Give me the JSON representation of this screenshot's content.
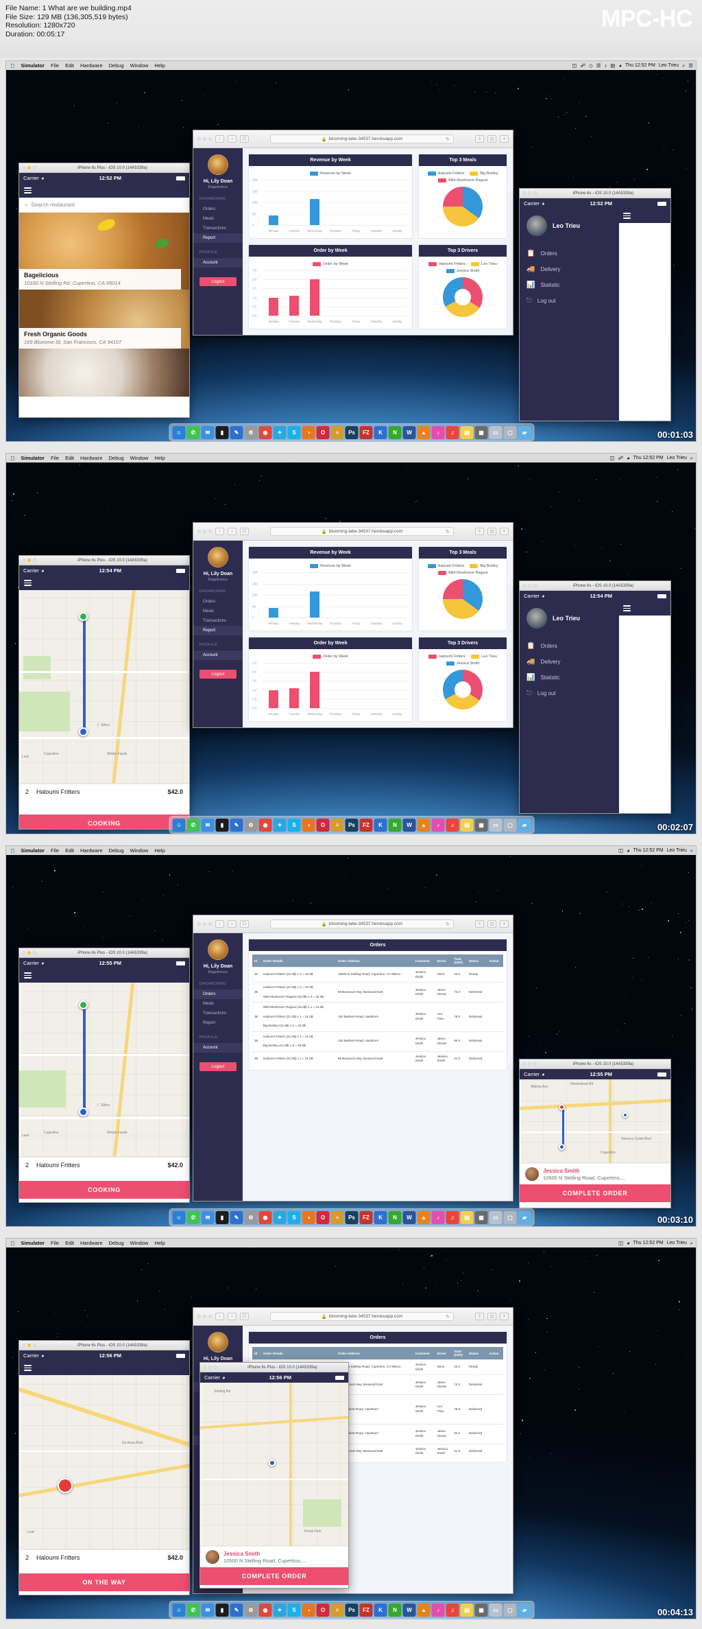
{
  "player": {
    "app_name": "MPC-HC",
    "info_lines": "File Name: 1 What are we building.mp4\nFile Size: 129 MB (136,305,519 bytes)\nResolution: 1280x720\nDuration: 00:05:17",
    "file_name": "1 What are we building.mp4",
    "file_size": "129 MB (136,305,519 bytes)",
    "resolution": "1280x720",
    "duration": "00:05:17"
  },
  "macbar": {
    "apple": "",
    "items": [
      "Simulator",
      "File",
      "Edit",
      "Hardware",
      "Debug",
      "Window",
      "Help"
    ],
    "right": [
      "Thu 12:52 PM",
      "Leo Trieu"
    ],
    "right_icons": [
      "display-icon",
      "bluetooth-icon",
      "dropbox-icon",
      "activity-icon",
      "battery-icon",
      "volume-icon",
      "wifi-icon",
      "search-icon",
      "menu-icon"
    ]
  },
  "safari": {
    "url": "blooming-lake-34537.herokuapp.com",
    "lock_icon": "lock-icon",
    "reload_icon": "reload-icon",
    "back_icon": "chevron-left-icon",
    "forward_icon": "chevron-right-icon",
    "sidebar_icon": "sidebar-icon",
    "share_icon": "share-icon",
    "tabs_icon": "tabs-icon",
    "newtab_icon": "plus-icon"
  },
  "dashboard": {
    "greeting": "Hi, Lily Doan",
    "restaurant": "Bagelicious",
    "section_dashboard": "DASHBOARD",
    "section_profile": "PROFILE",
    "links": [
      "Orders",
      "Meals",
      "Transactions",
      "Report"
    ],
    "profile_links": [
      "Account"
    ],
    "logout": "Logout",
    "active_link": "Report",
    "cards": {
      "revenue": "Revenue by Week",
      "order": "Order by Week",
      "top_meals": "Top 3 Meals",
      "top_drivers": "Top 3 Drivers",
      "orders_page": "Orders"
    }
  },
  "chart_data": [
    {
      "type": "bar",
      "title": "Revenue by Week",
      "legend": [
        "Revenue by Week"
      ],
      "legend_position": "top",
      "categories": [
        "Monday",
        "Tuesday",
        "Wednesday",
        "Thursday",
        "Friday",
        "Saturday",
        "Sunday"
      ],
      "values": [
        42,
        0,
        116,
        0,
        0,
        0,
        0
      ],
      "yticks": [
        "200",
        "150",
        "100",
        "50",
        "0"
      ],
      "ylim": [
        0,
        200
      ],
      "xlabel": "",
      "ylabel": "",
      "grid": true,
      "color": "#3498db"
    },
    {
      "type": "bar",
      "title": "Order by Week",
      "legend": [
        "Order by Week"
      ],
      "legend_position": "top",
      "categories": [
        "Monday",
        "Tuesday",
        "Wednesday",
        "Thursday",
        "Friday",
        "Saturday",
        "Sunday"
      ],
      "values": [
        1.0,
        1.1,
        2.0,
        0,
        0,
        0,
        0
      ],
      "yticks": [
        "2.5",
        "2.0",
        "1.5",
        "1.0",
        "0.5",
        "0.0"
      ],
      "ylim": [
        0,
        2.5
      ],
      "xlabel": "",
      "ylabel": "",
      "grid": true,
      "color": "#ec4f70"
    },
    {
      "type": "pie",
      "title": "Top 3 Meals",
      "legend": [
        "Haloumi Fritters",
        "Big Brekky",
        "Wild Mushroom Ragout"
      ],
      "labels": [
        "Haloumi Fritters",
        "Big Brekky",
        "Wild Mushroom Ragout"
      ],
      "values": [
        35,
        40,
        25
      ],
      "colors": [
        "#3498db",
        "#f5c53c",
        "#ec4f70"
      ],
      "legend_position": "top"
    },
    {
      "type": "pie",
      "title": "Top 3 Drivers",
      "legend": [
        "Haloumi Fritters",
        "Leo Trieu",
        "Jessica Smith"
      ],
      "labels": [
        "Haloumi Fritters",
        "Leo Trieu",
        "Jessica Smith"
      ],
      "values": [
        34,
        33,
        33
      ],
      "colors": [
        "#ec4f70",
        "#f5c53c",
        "#3498db"
      ],
      "legend_position": "top",
      "donut": true
    }
  ],
  "orders_table": {
    "title": "Orders",
    "columns": [
      "Id",
      "Order Details",
      "Order Address",
      "Customer",
      "Driver",
      "Total (USD)",
      "Status",
      "Action"
    ],
    "rows": [
      {
        "id": "45",
        "details": "Haloumi Fritters (21.0$) x 2 = 42.0$",
        "address": "10500 N Stelling Road, Cupertino, CA 95014",
        "customer": "Jessica Smith",
        "driver": "None",
        "total": "42.0",
        "status": "Ready",
        "action": ""
      },
      {
        "id": "39",
        "details": "Haloumi Fritters (21.0$) x 2 = 42.0$\nWild Mushroom Ragout (16.0$) x 2 = 32.0$",
        "address": "99 Burwood Hwy, Burwood East",
        "customer": "Jessica Smith",
        "driver": "Jason Gloran",
        "total": "74.0",
        "status": "Delivered",
        "action": ""
      },
      {
        "id": "38",
        "details": "Wild Mushroom Ragout (16.0$) x 1 = 16.0$\nHaloumi Fritters (21.0$) x 1 = 21.0$\nBig Brekky (21.0$) x 2 = 42.0$",
        "address": "162 Barkers Road, Hawthorn",
        "customer": "Jessica Smith",
        "driver": "Leo Trieu",
        "total": "79.0",
        "status": "Delivered",
        "action": ""
      },
      {
        "id": "36",
        "details": "Haloumi Fritters (21.0$) x 1 = 21.0$\nBig Brekky (21.0$) x 3 = 63.0$",
        "address": "162 Barkers Road, Hawthorn",
        "customer": "Jessica Smith",
        "driver": "Jason Gloran",
        "total": "84.0",
        "status": "Delivered",
        "action": ""
      },
      {
        "id": "35",
        "details": "Haloumi Fritters (21.0$) x 1 = 21.0$",
        "address": "99 Burwood Hwy, Burwood East",
        "customer": "Jessica Smith",
        "driver": "Jessica Smith",
        "total": "21.0",
        "status": "Delivered",
        "action": ""
      }
    ]
  },
  "customer_phone": {
    "sim_title": "iPhone 6s Plus - iOS 10.0 (14A5339a)",
    "search_placeholder": "Search restaurant",
    "search_icon": "search-icon",
    "menu_icon": "hamburger-icon",
    "carrier": "Carrier",
    "wifi_icon": "wifi-icon",
    "restaurants": [
      {
        "name": "Bagelicious",
        "address": "10100 N Stelling Rd, Cupertino, CA 95014"
      },
      {
        "name": "Fresh Organic Goods",
        "address": "169 Bluxome St, San Francisco, CA 94107"
      }
    ],
    "clocks": [
      "12:52 PM",
      "12:54 PM",
      "12:55 PM",
      "12:56 PM"
    ],
    "order": {
      "qty": "2",
      "name": "Haloumi Fritters",
      "price": "$42.0"
    },
    "statuses": [
      "COOKING",
      "COOKING",
      "ON THE WAY"
    ]
  },
  "driver_phone": {
    "sim_title": "iPhone 6s - iOS 10.0 (14A5339a)",
    "user": "Leo Trieu",
    "menu": [
      "Orders",
      "Delivery",
      "Statistic",
      "Log out"
    ],
    "menu_icons": [
      "orders-icon",
      "delivery-truck-icon",
      "statistic-icon",
      "logout-icon"
    ],
    "menu_icon": "hamburger-icon",
    "carrier": "Carrier",
    "clocks": [
      "12:52 PM",
      "12:54 PM",
      "12:55 PM",
      "12:56 PM"
    ],
    "delivery": {
      "customer": "Jessica Smith",
      "address": "10500 N Stelling Road, Cupertino,...",
      "cta": "COMPLETE ORDER"
    }
  },
  "map": {
    "pois": [
      "Cupertino",
      "Whole Foods",
      "Leaf",
      "Stelling Rd",
      "Homestead Rd",
      "Alberta Ave",
      "Stevens Creek Blvd",
      "De Anza Blvd"
    ]
  },
  "dock": {
    "items": [
      {
        "name": "finder-icon",
        "glyph": "☺",
        "color": "#2b7fd4"
      },
      {
        "name": "whatsapp-icon",
        "glyph": "✆",
        "color": "#3dc451"
      },
      {
        "name": "mail-icon",
        "glyph": "✉",
        "color": "#3f8fe0"
      },
      {
        "name": "terminal-icon",
        "glyph": "▮",
        "color": "#1d1d1d"
      },
      {
        "name": "xcode-icon",
        "glyph": "✎",
        "color": "#2f6fcf"
      },
      {
        "name": "preferences-icon",
        "glyph": "⚙",
        "color": "#9a9a9a"
      },
      {
        "name": "chrome-icon",
        "glyph": "◉",
        "color": "#e2473a"
      },
      {
        "name": "safari-icon",
        "glyph": "✦",
        "color": "#2aa7e0"
      },
      {
        "name": "skype-icon",
        "glyph": "S",
        "color": "#1eafe8"
      },
      {
        "name": "firefox-icon",
        "glyph": "◑",
        "color": "#e8761f"
      },
      {
        "name": "opera-icon",
        "glyph": "O",
        "color": "#d4283c"
      },
      {
        "name": "sublime-icon",
        "glyph": "≡",
        "color": "#d79a2b"
      },
      {
        "name": "photoshop-icon",
        "glyph": "Ps",
        "color": "#1b3f5e"
      },
      {
        "name": "filezilla-icon",
        "glyph": "FZ",
        "color": "#c5342b"
      },
      {
        "name": "keynote-icon",
        "glyph": "K",
        "color": "#2e6fd0"
      },
      {
        "name": "numbers-icon",
        "glyph": "N",
        "color": "#36a82f"
      },
      {
        "name": "word-icon",
        "glyph": "W",
        "color": "#2a5699"
      },
      {
        "name": "vlc-icon",
        "glyph": "▲",
        "color": "#e8821a"
      },
      {
        "name": "itunes-icon",
        "glyph": "♪",
        "color": "#e44db0"
      },
      {
        "name": "music-icon",
        "glyph": "♫",
        "color": "#e8453c"
      },
      {
        "name": "notes-icon",
        "glyph": "▤",
        "color": "#f2d04b"
      },
      {
        "name": "calculator-icon",
        "glyph": "▦",
        "color": "#6b6b6b"
      },
      {
        "name": "simulator-icon",
        "glyph": "▭",
        "color": "#b9c2cc"
      },
      {
        "name": "trash-icon",
        "glyph": "▢",
        "color": "#aeb6bf"
      },
      {
        "name": "folder-icon",
        "glyph": "▰",
        "color": "#5fb0e5"
      }
    ]
  },
  "frames": [
    {
      "timestamp": "00:01:03"
    },
    {
      "timestamp": "00:02:07"
    },
    {
      "timestamp": "00:03:10"
    },
    {
      "timestamp": "00:04:13"
    }
  ]
}
